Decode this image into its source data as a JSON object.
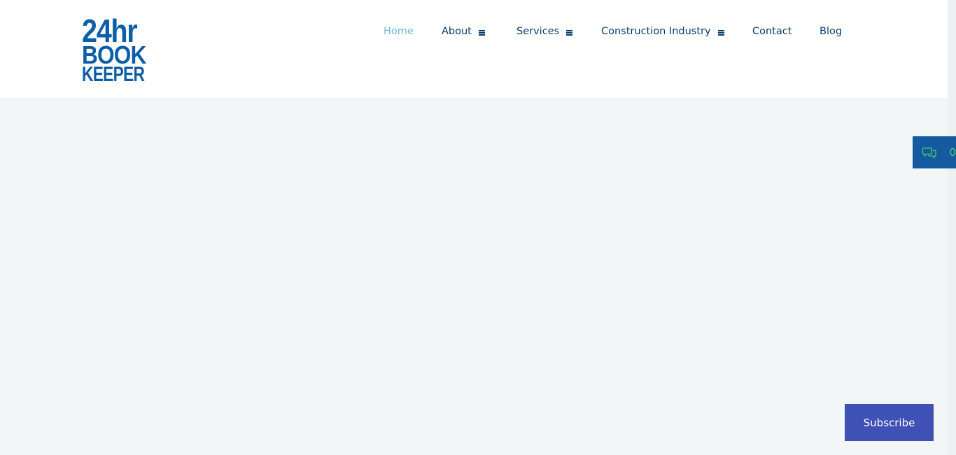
{
  "logo": {
    "line1": "24hr",
    "line2": "BOOK",
    "line3": "KEEPER"
  },
  "nav": {
    "items": [
      {
        "label": "Home",
        "active": true,
        "has_menu": false
      },
      {
        "label": "About",
        "active": false,
        "has_menu": true
      },
      {
        "label": "Services",
        "active": false,
        "has_menu": true
      },
      {
        "label": "Construction Industry",
        "active": false,
        "has_menu": true
      },
      {
        "label": "Contact",
        "active": false,
        "has_menu": false
      },
      {
        "label": "Blog",
        "active": false,
        "has_menu": false
      }
    ],
    "menu_icon": "hamburger-icon"
  },
  "chat_tab": {
    "icon": "chat-bubbles-icon",
    "text": "0"
  },
  "subscribe": {
    "label": "Subscribe"
  },
  "colors": {
    "brand_blue": "#0d5ea8",
    "nav_text": "#0b3c6e",
    "nav_active": "#6cb6dd",
    "chat_tab_bg": "#145aa0",
    "chat_accent": "#4dd46a",
    "subscribe_bg": "#3f51b5",
    "page_bg": "#f3f6f6"
  }
}
